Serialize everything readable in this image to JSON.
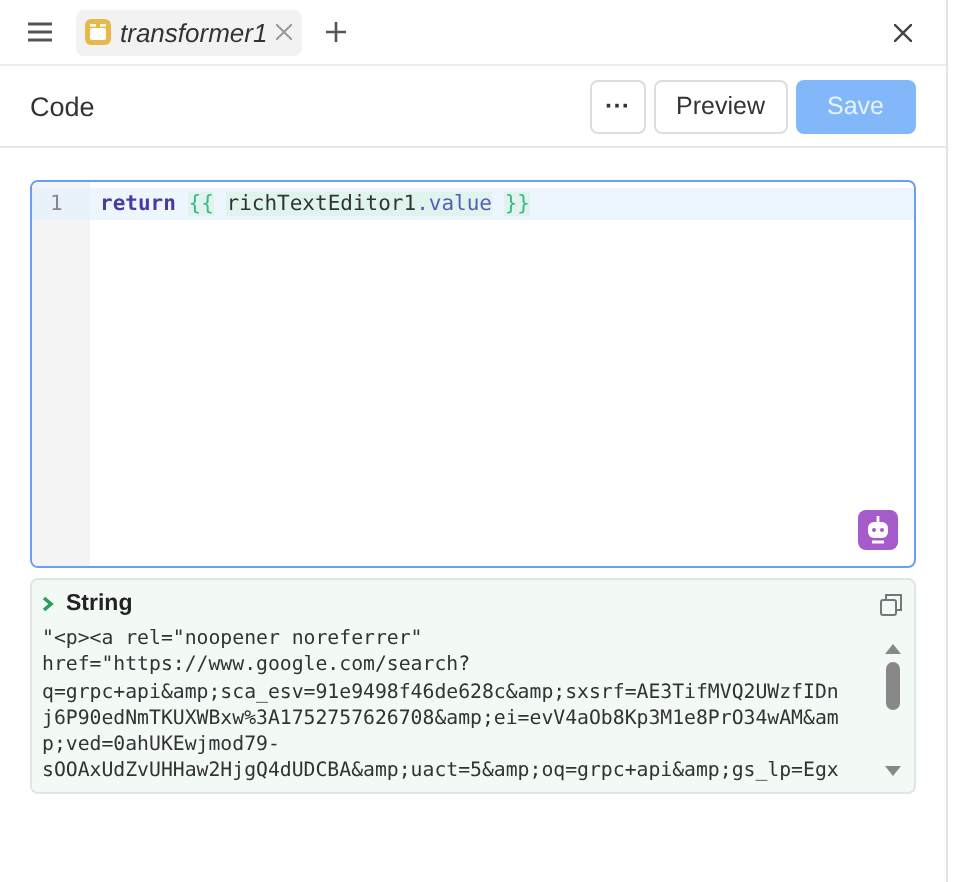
{
  "tabs": [
    {
      "label": "transformer1",
      "selected": true
    }
  ],
  "header": {
    "title": "Code",
    "buttons": [
      {
        "kind": "more",
        "label": "···"
      },
      {
        "kind": "secondary",
        "label": "Preview"
      },
      {
        "kind": "primary",
        "label": "Save",
        "disabled": true
      }
    ]
  },
  "editor": {
    "lines": [
      {
        "number": "1",
        "tokens": [
          {
            "kind": "keyword",
            "text": "return"
          },
          {
            "kind": "brace",
            "text": "{{"
          },
          {
            "kind": "identifier",
            "text": "richTextEditor1"
          },
          {
            "kind": "property",
            "text": ".value"
          },
          {
            "kind": "brace",
            "text": "}}"
          }
        ]
      }
    ]
  },
  "result": {
    "type": "String",
    "expanded": true,
    "lines": [
      "\"<p><a rel=\"noopener noreferrer\"",
      "href=\"https://www.google.com/search?",
      "q=grpc+api&amp;sca_esv=91e9498f46de628c&amp;sxsrf=AE3TifMVQ2UWzfIDn",
      "j6P90edNmTKUXWBxw%3A1752757626708&amp;ei=evV4aOb8Kp3M1e8PrO34wAM&am",
      "p;ved=0ahUKEwjmod79-",
      "sOOAxUdZvUHHaw2HjgQ4dUDCBA&amp;uact=5&amp;oq=grpc+api&amp;gs_lp=Egx"
    ]
  }
}
